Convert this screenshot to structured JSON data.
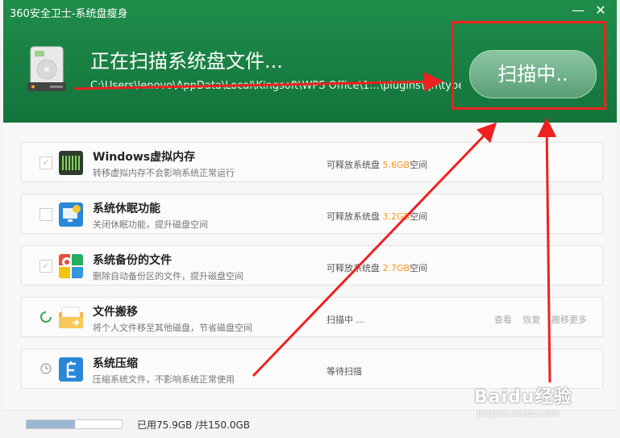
{
  "window": {
    "title": "360安全卫士-系统盘瘦身",
    "minimize": "—",
    "close": "✕"
  },
  "header": {
    "headline": "正在扫描系统盘文件...",
    "path": "C:\\Users\\lenovo\\AppData\\Local\\Kingsoft\\WPS Office\\1...\\plugins\\qh\\types",
    "button": "扫描中.."
  },
  "items": [
    {
      "name": "Windows虚拟内存",
      "desc": "转移虚拟内存不会影响系统正常运行",
      "status_prefix": "可释放系统盘 ",
      "status_value": "5.6GB",
      "status_suffix": "空间",
      "checked": true,
      "icon": "memory-icon"
    },
    {
      "name": "系统休眠功能",
      "desc": "关闭休眠功能，提升磁盘空间",
      "status_prefix": "可释放系统盘 ",
      "status_value": "3.2GB",
      "status_suffix": "空间",
      "checked": false,
      "icon": "sleep-icon"
    },
    {
      "name": "系统备份的文件",
      "desc": "删除自动备份区的文件，提升磁盘空间",
      "status_prefix": "可释放系统盘 ",
      "status_value": "2.7GB",
      "status_suffix": "空间",
      "checked": true,
      "icon": "backup-icon"
    },
    {
      "name": "文件搬移",
      "desc": "将个人文件移至其他磁盘，节省磁盘空间",
      "status_prefix": "扫描中 ...",
      "actions": [
        "查看",
        "恢复",
        "搬移更多"
      ],
      "icon": "folder-move-icon"
    },
    {
      "name": "系统压缩",
      "desc": "压缩系统文件，不影响系统正常使用",
      "status_prefix": "等待扫描",
      "icon": "compress-icon"
    }
  ],
  "footer": {
    "usage": "已用75.9GB /共150.0GB",
    "used_fraction": 0.506
  },
  "watermark": {
    "main": "Baidu经验",
    "sub": "jingyan.baidu.com"
  },
  "colors": {
    "header": "#1a7f43",
    "highlight": "#f5941f",
    "annotation": "#f02020"
  }
}
